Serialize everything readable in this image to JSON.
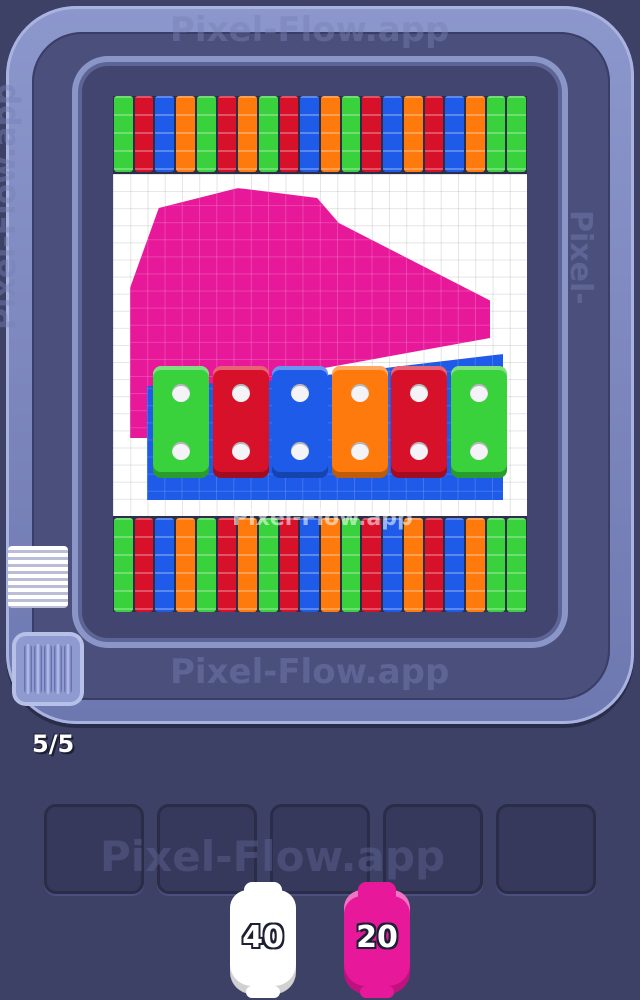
{
  "watermark": "Pixel-Flow.app",
  "counter": "5/5",
  "colors": {
    "green": "#39d13c",
    "red": "#d8112b",
    "blue": "#1d5be8",
    "orange": "#ff7a0d",
    "pink": "#e8189a",
    "white": "#ffffff"
  },
  "board": {
    "top_stripes": [
      "green",
      "red",
      "blue",
      "orange",
      "green",
      "red",
      "orange",
      "green",
      "red",
      "blue",
      "orange",
      "green",
      "red",
      "blue",
      "orange",
      "red",
      "blue",
      "orange",
      "green",
      "green"
    ],
    "bottom_stripes": [
      "green",
      "red",
      "blue",
      "orange",
      "green",
      "red",
      "orange",
      "green",
      "red",
      "blue",
      "orange",
      "green",
      "red",
      "blue",
      "orange",
      "red",
      "blue",
      "orange",
      "green",
      "green"
    ],
    "blocks": [
      "green",
      "red",
      "blue",
      "orange",
      "red",
      "green"
    ]
  },
  "slots_count_label": "",
  "shooters": [
    {
      "color": "white",
      "count": "40"
    },
    {
      "color": "pink",
      "count": "20"
    }
  ]
}
